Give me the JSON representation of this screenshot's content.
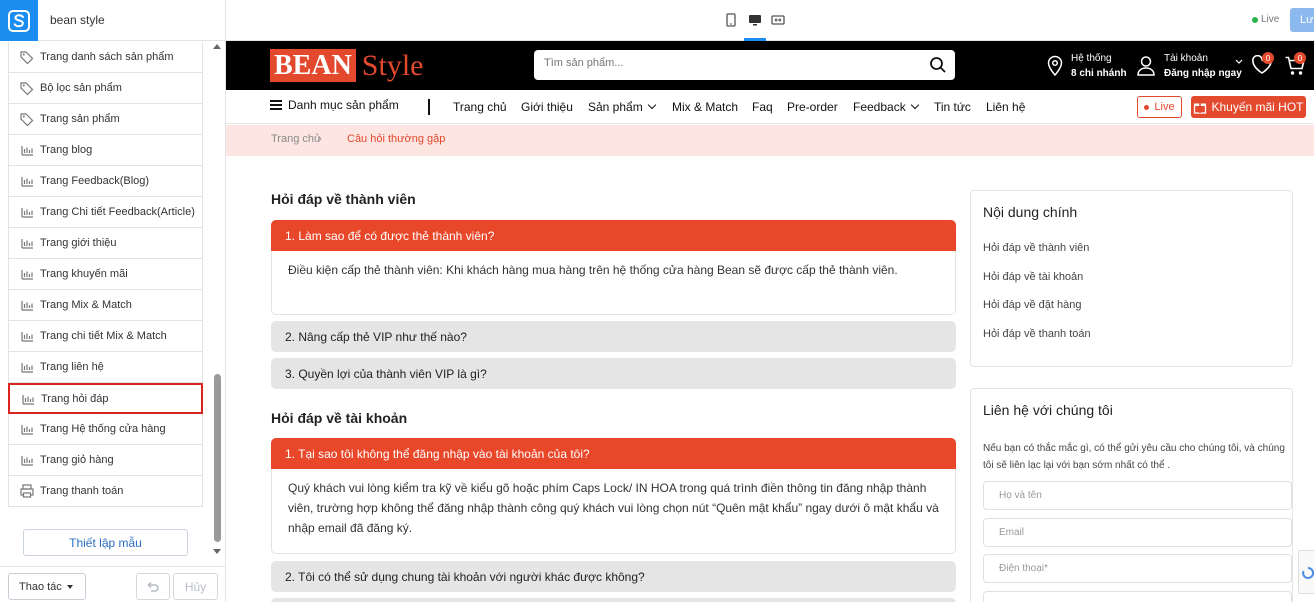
{
  "editor": {
    "store_name": "bean style",
    "pages": [
      {
        "label": "Trang danh sách sản phẩm",
        "icon": "tag-icon"
      },
      {
        "label": "Bộ lọc sản phẩm",
        "icon": "tag-icon"
      },
      {
        "label": "Trang sản phẩm",
        "icon": "tag-icon"
      },
      {
        "label": "Trang blog",
        "icon": "blog-icon"
      },
      {
        "label": "Trang Feedback(Blog)",
        "icon": "blog-icon"
      },
      {
        "label": "Trang Chi tiết Feedback(Article)",
        "icon": "blog-icon"
      },
      {
        "label": "Trang giới thiệu",
        "icon": "blog-icon"
      },
      {
        "label": "Trang khuyến mãi",
        "icon": "blog-icon"
      },
      {
        "label": "Trang Mix & Match",
        "icon": "blog-icon"
      },
      {
        "label": "Trang chi tiết Mix & Match",
        "icon": "blog-icon"
      },
      {
        "label": "Trang liên hệ",
        "icon": "blog-icon"
      },
      {
        "label": "Trang hỏi đáp",
        "icon": "blog-icon",
        "selected": true
      },
      {
        "label": "Trang Hệ thống cửa hàng",
        "icon": "blog-icon"
      },
      {
        "label": "Trang giỏ hàng",
        "icon": "blog-icon"
      },
      {
        "label": "Trang thanh toán",
        "icon": "printer-icon"
      }
    ],
    "setup_button": "Thiết lập mẫu",
    "actions_label": "Thao tác",
    "cancel_label": "Hủy",
    "live_label": "Live",
    "save_label": "Lư"
  },
  "site": {
    "brand_main": "BEAN",
    "brand_sub": "Style",
    "search_placeholder": "Tìm sản phẩm...",
    "stores_line1": "Hệ thống",
    "stores_line2": "8 chi nhánh",
    "account_line1": "Tài khoản",
    "account_line2": "Đăng nhập ngay",
    "wishlist_count": "0",
    "cart_count": "0",
    "category_menu": "Danh mục sản phẩm",
    "nav": [
      "Trang chủ",
      "Giới thiệu",
      "Sản phẩm",
      "Mix & Match",
      "Faq",
      "Pre-order",
      "Feedback",
      "Tin tức",
      "Liên hệ"
    ],
    "live_button": "Live",
    "promo_button": "Khuyến mãi HOT",
    "breadcrumb_home": "Trang chủ",
    "breadcrumb_sep": "›",
    "breadcrumb_current": "Câu hỏi thường gặp",
    "colors": {
      "brand": "#e2492d",
      "header_bg": "#000000",
      "accent_blue": "#1b8cf0"
    }
  },
  "faq": {
    "member_title": "Hỏi đáp về thành viên",
    "member_q1": "1. Làm sao để có được thẻ thành viên?",
    "member_a1": "Điều kiện cấp thẻ thành viên: Khi khách hàng mua hàng trên hệ thống cửa hàng Bean sẽ được cấp thẻ thành viên.",
    "member_q2": "2. Nâng cấp thẻ VIP như thế nào?",
    "member_q3": "3. Quyền lợi của thành viên VIP là gì?",
    "account_title": "Hỏi đáp về tài khoản",
    "account_q1": "1. Tại sao tôi không thể đăng nhập vào tài khoản của tôi?",
    "account_a1": "Quý khách vui lòng kiểm tra kỹ về kiểu gõ hoặc phím Caps Lock/ IN HOA trong quá trình điền thông tin đăng nhập thành viên, trường hợp không thể đăng nhập thành công quý khách vui lòng chọn nút “Quên mật khẩu” ngay dưới ô mật khẩu và nhập email đã đăng ký.",
    "account_q2": "2. Tôi có thể sử dụng chung tài khoản với người khác được không?"
  },
  "sidebar_right": {
    "contents_title": "Nội dung chính",
    "contents_links": [
      "Hỏi đáp về thành viên",
      "Hỏi đáp về tài khoản",
      "Hỏi đáp về đặt hàng",
      "Hỏi đáp về thanh toán"
    ],
    "contact_title": "Liên hệ với chúng tôi",
    "contact_desc": "Nếu bạn có thắc mắc gì, có thể gửi yêu cầu cho chúng tôi, và chúng tôi sẽ liên lạc lại với bạn sớm nhất có thể .",
    "name_placeholder": "Họ và tên",
    "email_placeholder": "Email",
    "phone_placeholder": "Điện thoại*"
  }
}
